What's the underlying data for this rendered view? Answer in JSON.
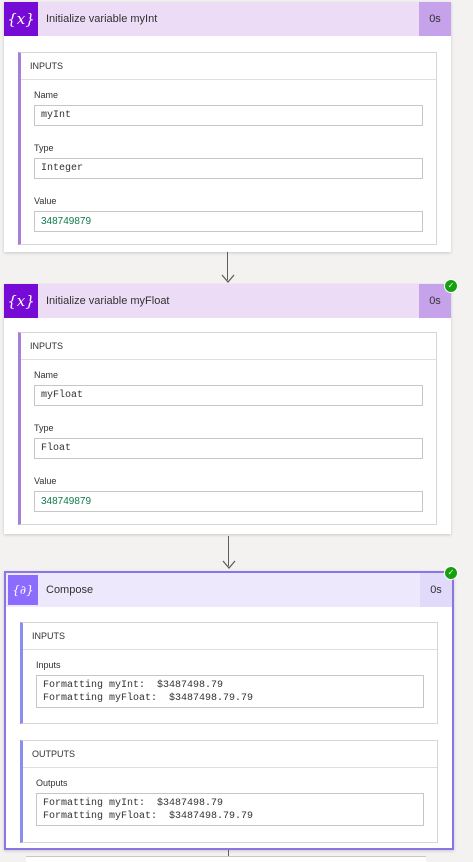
{
  "cards": [
    {
      "title": "Initialize variable myInt",
      "duration": "0s",
      "icon": "{x}",
      "inputs_header": "INPUTS",
      "fields": [
        {
          "label": "Name",
          "value": "myInt"
        },
        {
          "label": "Type",
          "value": "Integer"
        },
        {
          "label": "Value",
          "value": "348749879"
        }
      ]
    },
    {
      "title": "Initialize variable myFloat",
      "duration": "0s",
      "icon": "{x}",
      "inputs_header": "INPUTS",
      "fields": [
        {
          "label": "Name",
          "value": "myFloat"
        },
        {
          "label": "Type",
          "value": "Float"
        },
        {
          "label": "Value",
          "value": "348749879"
        }
      ]
    },
    {
      "title": "Compose",
      "duration": "0s",
      "icon": "{∂}",
      "inputs_header": "INPUTS",
      "inputs_label": "Inputs",
      "inputs_value": "Formatting myInt:  $3487498.79\nFormatting myFloat:  $3487498.79.79",
      "outputs_header": "OUTPUTS",
      "outputs_label": "Outputs",
      "outputs_value": "Formatting myInt:  $3487498.79\nFormatting myFloat:  $3487498.79.79"
    }
  ],
  "status_icon": "✓",
  "colors": {
    "variable_accent": "#770bd6",
    "compose_accent": "#8c6cff",
    "success": "#13a10e"
  }
}
